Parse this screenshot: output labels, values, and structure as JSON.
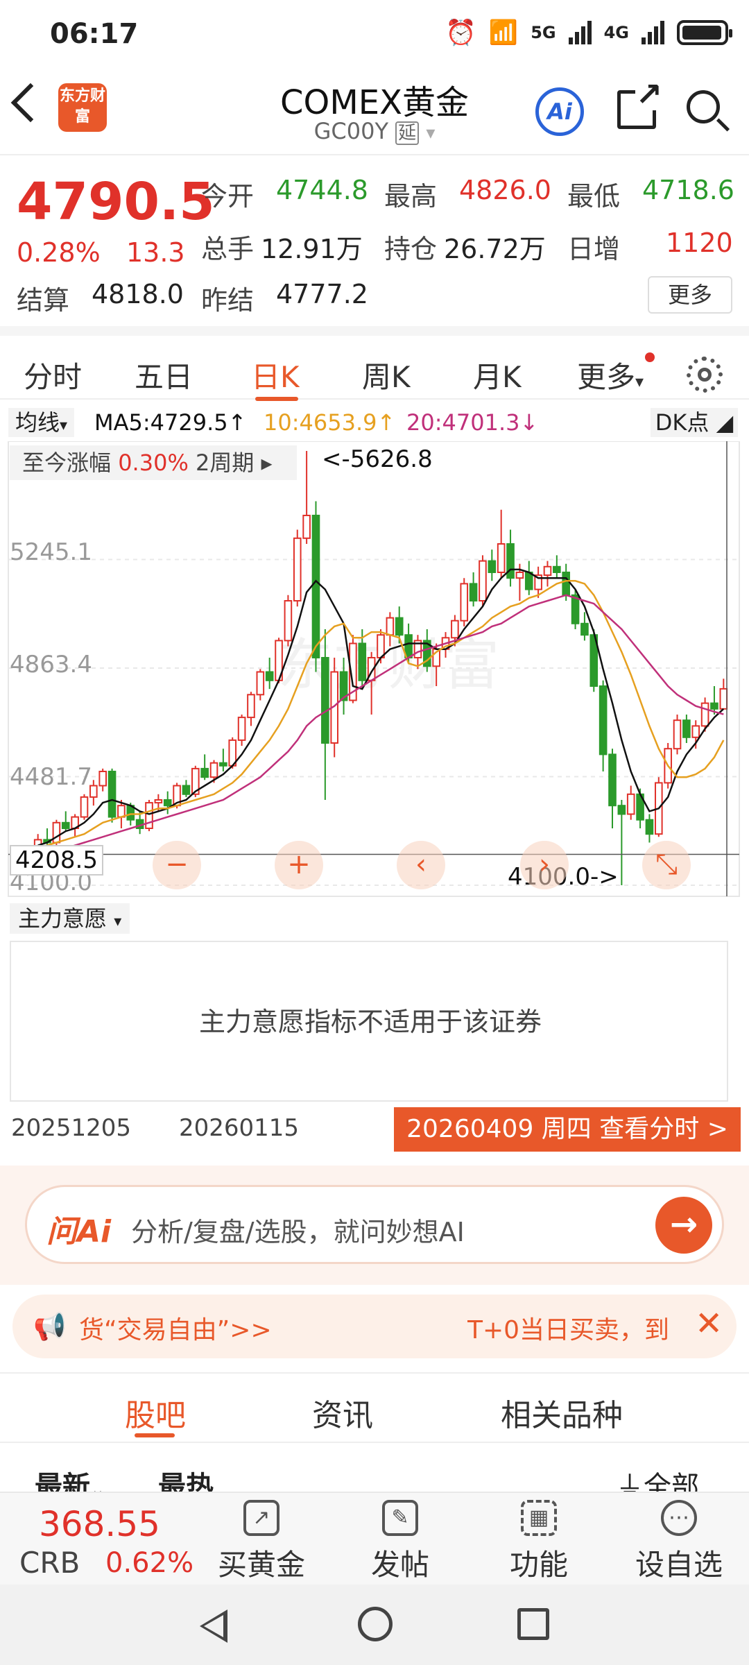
{
  "status_bar": {
    "time": "06:17",
    "net1": "5G",
    "net2": "4G",
    "wifi_label": "6"
  },
  "header": {
    "logo_text": "东方财富",
    "title": "COMEX黄金",
    "subtitle": "GC00Y",
    "subtitle_tag": "延",
    "ai_label": "Ai"
  },
  "quote": {
    "price": "4790.5",
    "change_pct": "0.28%",
    "change": "13.3",
    "open_label": "今开",
    "open": "4744.8",
    "high_label": "最高",
    "high": "4826.0",
    "low_label": "最低",
    "low": "4718.6",
    "volume_label": "总手",
    "volume": "12.91万",
    "oi_label": "持仓",
    "oi": "26.72万",
    "daily_inc_label": "日增",
    "daily_inc": "1120",
    "settle_label": "结算",
    "settle": "4818.0",
    "prev_settle_label": "昨结",
    "prev_settle": "4777.2",
    "more_label": "更多"
  },
  "period_tabs": [
    "分时",
    "五日",
    "日K",
    "周K",
    "月K",
    "更多"
  ],
  "active_period": "日K",
  "ma_legend": {
    "selector": "均线",
    "ma5": "MA5:4729.5↑",
    "ma10": "10:4653.9↑",
    "ma20": "20:4701.3↓",
    "dk": "DK点"
  },
  "colors": {
    "accent": "#e8582a",
    "up": "#e0312a",
    "down": "#2b9a2b",
    "ma5": "#111111",
    "ma10": "#e6a020",
    "ma20": "#c0307a"
  },
  "chart": {
    "range_label": "至今涨幅",
    "range_pct": "0.30%",
    "range_period": "2周期 ▸",
    "max_label": "<-5626.8",
    "min_label": "4100.0->",
    "cursor_price": "4208.5",
    "y_ticks": [
      "5245.1",
      "4863.4",
      "4481.7",
      "4100.0"
    ],
    "controls": [
      "−",
      "+",
      "‹",
      "›",
      "⤡"
    ]
  },
  "chart_data": {
    "type": "candlestick",
    "y_ticks": [
      5245.1,
      4863.4,
      4481.7,
      4100.0
    ],
    "ylim": [
      4100.0,
      5626.8
    ],
    "ohlc": [
      [
        4220,
        4280,
        4190,
        4260
      ],
      [
        4260,
        4300,
        4230,
        4250
      ],
      [
        4250,
        4330,
        4240,
        4320
      ],
      [
        4320,
        4360,
        4290,
        4300
      ],
      [
        4300,
        4350,
        4270,
        4340
      ],
      [
        4340,
        4420,
        4330,
        4410
      ],
      [
        4410,
        4470,
        4380,
        4450
      ],
      [
        4450,
        4510,
        4430,
        4500
      ],
      [
        4500,
        4510,
        4320,
        4340
      ],
      [
        4340,
        4400,
        4300,
        4380
      ],
      [
        4380,
        4390,
        4310,
        4330
      ],
      [
        4330,
        4360,
        4280,
        4300
      ],
      [
        4300,
        4400,
        4290,
        4390
      ],
      [
        4390,
        4420,
        4360,
        4400
      ],
      [
        4400,
        4430,
        4350,
        4380
      ],
      [
        4380,
        4460,
        4370,
        4450
      ],
      [
        4450,
        4470,
        4410,
        4420
      ],
      [
        4420,
        4520,
        4410,
        4510
      ],
      [
        4510,
        4560,
        4470,
        4480
      ],
      [
        4480,
        4540,
        4460,
        4530
      ],
      [
        4530,
        4580,
        4500,
        4520
      ],
      [
        4520,
        4620,
        4510,
        4610
      ],
      [
        4610,
        4700,
        4590,
        4690
      ],
      [
        4690,
        4780,
        4660,
        4770
      ],
      [
        4770,
        4860,
        4750,
        4850
      ],
      [
        4850,
        4900,
        4790,
        4820
      ],
      [
        4820,
        4970,
        4810,
        4960
      ],
      [
        4960,
        5120,
        4940,
        5100
      ],
      [
        5100,
        5350,
        5080,
        5320
      ],
      [
        5320,
        5626.8,
        5300,
        5400
      ],
      [
        5400,
        5450,
        4850,
        4900
      ],
      [
        4900,
        5000,
        4400,
        4600
      ],
      [
        4600,
        4900,
        4550,
        4850
      ],
      [
        4850,
        4900,
        4700,
        4750
      ],
      [
        4750,
        4980,
        4740,
        4950
      ],
      [
        4950,
        5000,
        4800,
        4820
      ],
      [
        4820,
        4920,
        4700,
        4900
      ],
      [
        4900,
        5000,
        4880,
        4980
      ],
      [
        4980,
        5060,
        4940,
        5040
      ],
      [
        5040,
        5080,
        4950,
        4980
      ],
      [
        4980,
        5020,
        4880,
        4900
      ],
      [
        4900,
        4980,
        4860,
        4960
      ],
      [
        4960,
        5000,
        4850,
        4870
      ],
      [
        4870,
        4950,
        4800,
        4930
      ],
      [
        4930,
        4990,
        4900,
        4970
      ],
      [
        4970,
        5050,
        4940,
        5030
      ],
      [
        5030,
        5180,
        5010,
        5160
      ],
      [
        5160,
        5200,
        5080,
        5100
      ],
      [
        5100,
        5260,
        5080,
        5240
      ],
      [
        5240,
        5280,
        5170,
        5200
      ],
      [
        5200,
        5420,
        5180,
        5300
      ],
      [
        5300,
        5350,
        5150,
        5180
      ],
      [
        5180,
        5230,
        5100,
        5200
      ],
      [
        5200,
        5240,
        5120,
        5140
      ],
      [
        5140,
        5220,
        5110,
        5190
      ],
      [
        5190,
        5240,
        5150,
        5220
      ],
      [
        5220,
        5260,
        5180,
        5200
      ],
      [
        5200,
        5230,
        5100,
        5120
      ],
      [
        5120,
        5140,
        5000,
        5020
      ],
      [
        5020,
        5060,
        4960,
        4980
      ],
      [
        4980,
        5000,
        4780,
        4800
      ],
      [
        4800,
        4820,
        4500,
        4560
      ],
      [
        4560,
        4580,
        4300,
        4380
      ],
      [
        4380,
        4400,
        4100,
        4350
      ],
      [
        4350,
        4450,
        4330,
        4420
      ],
      [
        4420,
        4440,
        4300,
        4330
      ],
      [
        4330,
        4350,
        4250,
        4280
      ],
      [
        4280,
        4480,
        4270,
        4460
      ],
      [
        4460,
        4600,
        4440,
        4580
      ],
      [
        4580,
        4700,
        4560,
        4680
      ],
      [
        4680,
        4700,
        4600,
        4620
      ],
      [
        4620,
        4680,
        4580,
        4660
      ],
      [
        4660,
        4760,
        4640,
        4740
      ],
      [
        4740,
        4800,
        4700,
        4720
      ],
      [
        4720,
        4826,
        4718.6,
        4790.5
      ]
    ],
    "series": [
      {
        "name": "MA5",
        "values": [
          4240,
          4250,
          4270,
          4290,
          4300,
          4320,
          4350,
          4390,
          4400,
          4390,
          4380,
          4360,
          4350,
          4360,
          4370,
          4390,
          4400,
          4430,
          4450,
          4470,
          4490,
          4520,
          4560,
          4610,
          4680,
          4750,
          4820,
          4910,
          5010,
          5130,
          5170,
          5140,
          5080,
          5020,
          4800,
          4790,
          4850,
          4900,
          4930,
          4940,
          4950,
          4950,
          4950,
          4930,
          4930,
          4950,
          5000,
          5040,
          5080,
          5140,
          5180,
          5210,
          5210,
          5200,
          5180,
          5180,
          5180,
          5180,
          5140,
          5080,
          4990,
          4860,
          4740,
          4610,
          4500,
          4420,
          4360,
          4370,
          4410,
          4500,
          4560,
          4600,
          4650,
          4690,
          4720
        ]
      },
      {
        "name": "MA10",
        "values": [
          4230,
          4240,
          4250,
          4260,
          4270,
          4280,
          4300,
          4320,
          4330,
          4340,
          4350,
          4350,
          4360,
          4370,
          4370,
          4380,
          4390,
          4400,
          4410,
          4420,
          4440,
          4460,
          4490,
          4530,
          4570,
          4610,
          4660,
          4720,
          4800,
          4880,
          4940,
          4980,
          5010,
          5020,
          4970,
          4970,
          4990,
          4990,
          4980,
          4970,
          4880,
          4870,
          4890,
          4920,
          4940,
          4950,
          4970,
          4990,
          5010,
          5040,
          5060,
          5080,
          5090,
          5110,
          5120,
          5140,
          5160,
          5170,
          5170,
          5160,
          5120,
          5060,
          4990,
          4920,
          4840,
          4750,
          4660,
          4580,
          4520,
          4480,
          4480,
          4490,
          4510,
          4550,
          4610
        ]
      },
      {
        "name": "MA20",
        "values": [
          4200,
          4210,
          4220,
          4230,
          4240,
          4250,
          4260,
          4270,
          4280,
          4290,
          4300,
          4310,
          4320,
          4330,
          4340,
          4350,
          4360,
          4370,
          4380,
          4390,
          4400,
          4420,
          4440,
          4460,
          4480,
          4510,
          4540,
          4570,
          4610,
          4660,
          4690,
          4710,
          4730,
          4760,
          4780,
          4800,
          4820,
          4840,
          4860,
          4880,
          4900,
          4920,
          4930,
          4940,
          4950,
          4960,
          4970,
          4980,
          4990,
          5010,
          5020,
          5040,
          5060,
          5080,
          5090,
          5100,
          5110,
          5120,
          5110,
          5100,
          5090,
          5060,
          5030,
          5000,
          4960,
          4920,
          4880,
          4840,
          4800,
          4770,
          4750,
          4730,
          4720,
          4710,
          4701
        ]
      }
    ]
  },
  "sub_indicator": {
    "selector": "主力意愿",
    "message": "主力意愿指标不适用于该证券"
  },
  "date_bar": {
    "start": "20251205",
    "mid": "20260115",
    "selected": "20260409 周四 查看分时 >"
  },
  "ai_bar": {
    "logo": "问Ai",
    "placeholder": "分析/复盘/选股，就问妙想AI",
    "go_icon": "arrow-right"
  },
  "promo": {
    "left": "货“交易自由”>>",
    "right": "T+0当日买卖，到"
  },
  "content_tabs": [
    "股吧",
    "资讯",
    "相关品种"
  ],
  "sort_row": {
    "latest": "最新",
    "hot": "最热",
    "filter": "全部"
  },
  "bottom_bar": {
    "ticker_price": "368.55",
    "ticker_name": "CRB",
    "ticker_pct": "0.62%",
    "items": [
      "买黄金",
      "发帖",
      "功能",
      "设自选"
    ]
  }
}
